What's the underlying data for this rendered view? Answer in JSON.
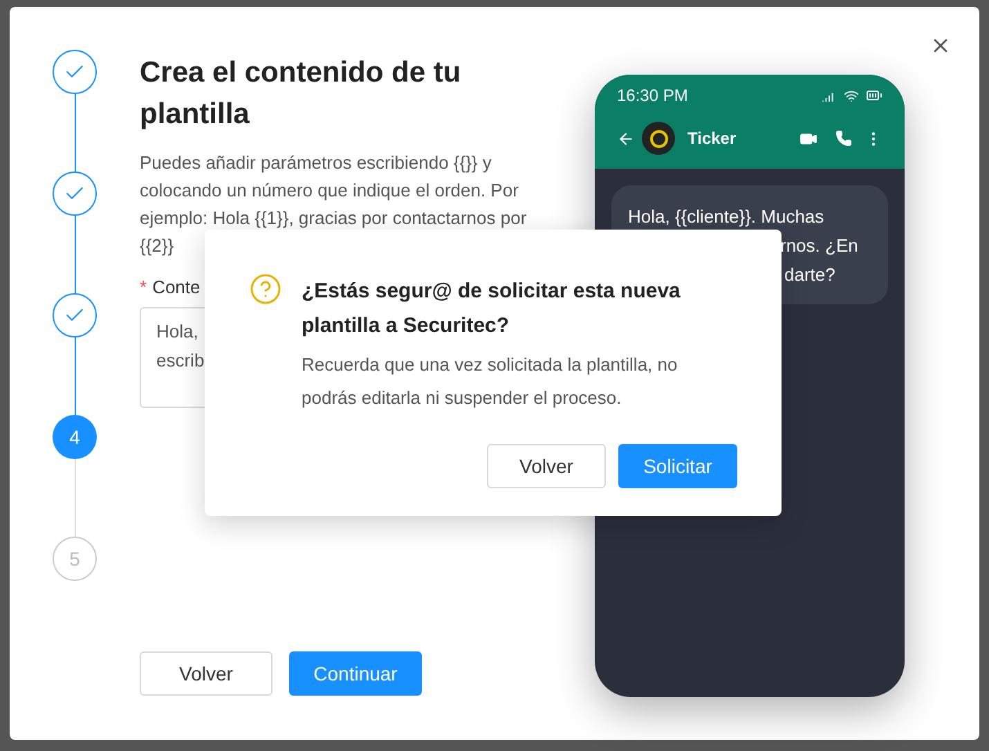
{
  "steps": [
    {
      "completed": true,
      "selected": false
    },
    {
      "completed": true,
      "selected": false
    },
    {
      "completed": true,
      "selected": false
    },
    {
      "completed": false,
      "selected": true,
      "label": "4"
    },
    {
      "completed": false,
      "selected": false,
      "label": "5"
    }
  ],
  "title": "Crea el contenido de tu plantilla",
  "description": "Puedes añadir parámetros escribiendo {{}} y colocando un número que indique el orden. Por ejemplo: Hola {{1}}, gracias por contactarnos por {{2}}",
  "field": {
    "required_mark": "*",
    "label": "Conte",
    "value_lines": [
      "Hola,",
      "escrib"
    ]
  },
  "buttons": [
    {
      "label": "Volver",
      "kind": "secondary"
    },
    {
      "label": "Continuar",
      "kind": "primary"
    }
  ],
  "phone": {
    "time": "16:30 PM",
    "contact": "Ticker",
    "message_lines": [
      "Hola, {{cliente}}. Muchas",
      "rnos. ¿En",
      "darte?"
    ]
  },
  "dialog": {
    "title": "¿Estás segur@ de solicitar esta nueva plantilla a Securitec?",
    "body": "Recuerda que una vez solicitada la plantilla, no podrás editarla ni suspender el proceso.",
    "buttons": [
      {
        "label": "Volver",
        "kind": "secondary"
      },
      {
        "label": "Solicitar",
        "kind": "primary"
      }
    ]
  }
}
